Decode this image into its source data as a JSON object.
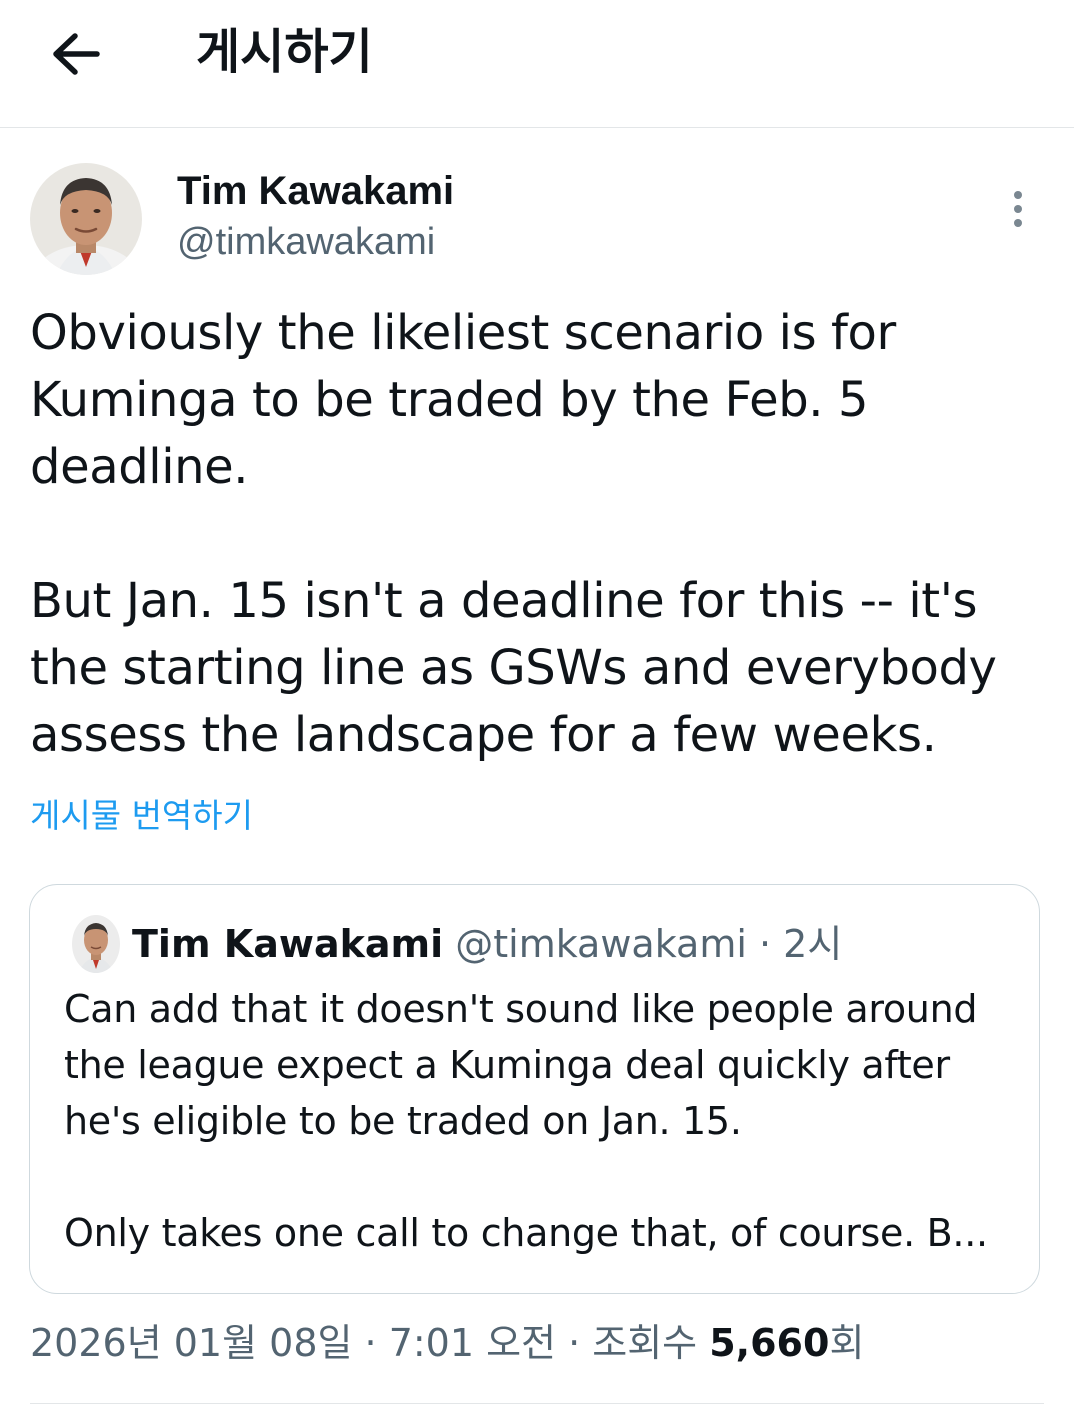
{
  "header": {
    "back_icon": "arrow-left-icon",
    "title": "게시하기"
  },
  "tweet": {
    "author": {
      "name": "Tim Kawakami",
      "handle": "@timkawakami",
      "avatar": "profile-photo"
    },
    "more_icon": "more-vertical-icon",
    "text": "Obviously the likeliest scenario is for\nKuminga to be traded by the Feb. 5\ndeadline.\n\nBut Jan. 15 isn't a deadline for this -- it's\nthe starting line as GSWs and everybody\nassess the landscape for a few weeks.",
    "translate_label": "게시물 번역하기",
    "quote": {
      "author_name": "Tim Kawakami",
      "author_handle": "@timkawakami",
      "separator": " · ",
      "time": "2시",
      "text": "Can add that it doesn't sound like people around\nthe league expect a Kuminga deal quickly after\nhe's eligible to be traded on Jan. 15.\n\nOnly takes one call to change that, of course. B..."
    },
    "meta": {
      "date_time": "2026년 01월 08일 · 7:01 오전 · 조회수 ",
      "views": "5,660",
      "views_suffix": "회"
    }
  },
  "colors": {
    "text_primary": "#0f1419",
    "text_secondary": "#536471",
    "link": "#1d9bf0",
    "border": "#cfd9de"
  }
}
